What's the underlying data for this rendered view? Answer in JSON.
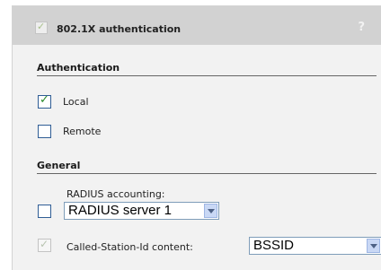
{
  "header": {
    "title": "802.1X authentication",
    "help": "?"
  },
  "authentication": {
    "heading": "Authentication",
    "local_label": "Local",
    "remote_label": "Remote"
  },
  "general": {
    "heading": "General",
    "radius_accounting_label": "RADIUS accounting:",
    "radius_server_value": "RADIUS server 1",
    "called_station_label": "Called-Station-Id content:",
    "called_station_value": "BSSID"
  },
  "state": {
    "header_enabled": true,
    "local_checked": true,
    "remote_checked": false,
    "radius_accounting_checked": false,
    "called_station_checked": true
  }
}
